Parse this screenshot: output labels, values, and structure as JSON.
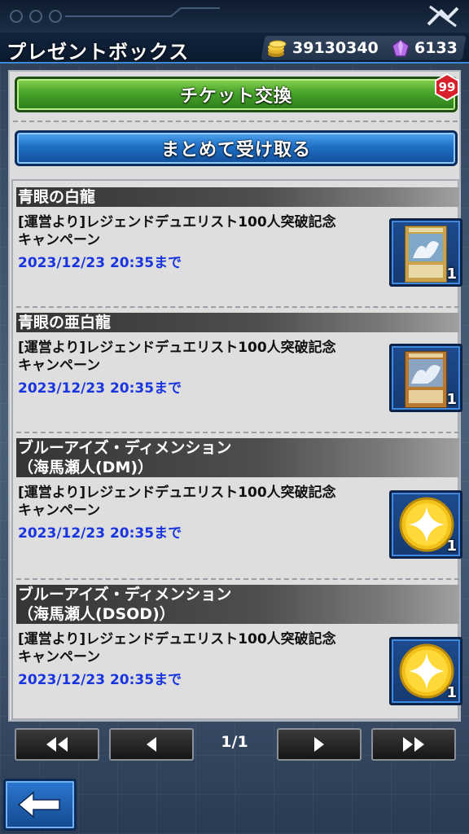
{
  "header": {
    "title": "プレゼントボックス",
    "coins": "39130340",
    "gems": "6133"
  },
  "actions": {
    "ticket_exchange": "チケット交換",
    "ticket_badge": "99",
    "receive_all": "まとめて受け取る"
  },
  "items": [
    {
      "name": "青眼の白龍",
      "name_line2": "",
      "desc_line1": "[運営より]レジェンドデュエリスト100人突破記念",
      "desc_line2": "キャンペーン",
      "deadline": "2023/12/23 20:35まで",
      "quantity": "1",
      "icon": "card-icon"
    },
    {
      "name": "青眼の亜白龍",
      "name_line2": "",
      "desc_line1": "[運営より]レジェンドデュエリスト100人突破記念",
      "desc_line2": "キャンペーン",
      "deadline": "2023/12/23 20:35まで",
      "quantity": "1",
      "icon": "card-icon"
    },
    {
      "name": "ブルーアイズ・ディメンション",
      "name_line2": "（海馬瀬人(DM)）",
      "desc_line1": "[運営より]レジェンドデュエリスト100人突破記念",
      "desc_line2": "キャンペーン",
      "deadline": "2023/12/23 20:35まで",
      "quantity": "1",
      "icon": "skill-star-icon"
    },
    {
      "name": "ブルーアイズ・ディメンション",
      "name_line2": "（海馬瀬人(DSOD)）",
      "desc_line1": "[運営より]レジェンドデュエリスト100人突破記念",
      "desc_line2": "キャンペーン",
      "deadline": "2023/12/23 20:35まで",
      "quantity": "1",
      "icon": "skill-star-icon"
    }
  ],
  "pagination": {
    "page": "1/1"
  },
  "colors": {
    "deadline": "#1a35e0",
    "green_button": "#47a42a",
    "blue_button": "#1f6fc6",
    "badge": "#d8202a"
  }
}
